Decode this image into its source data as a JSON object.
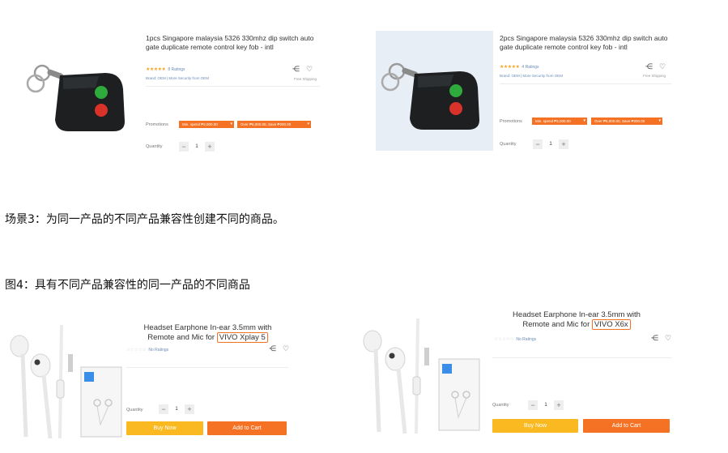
{
  "captions": {
    "scene3": "场景3：为同一产品的不同产品兼容性创建不同的商品。",
    "figure4": "图4：具有不同产品兼容性的同一产品的不同商品"
  },
  "colors": {
    "accent": "#f57224",
    "buy": "#fbb921",
    "star": "#f5a623",
    "link": "#6a8bb6"
  },
  "cards": [
    {
      "title": "1pcs Singapore malaysia 5326 330mhz dip switch auto gate duplicate remote control key fob - intl",
      "stars": "★★★★★",
      "rating_text": "8 Ratings",
      "brand_line": "Brand: OEM | More Security from OEM",
      "shipping": "Free Shipping",
      "promotions_label": "Promotions",
      "promo_1": "Min. spend ₱2,000.00",
      "promo_2": "Over ₱6,000.00, Save ₱200.00",
      "quantity_label": "Quantity",
      "minus": "−",
      "quantity": "1",
      "plus": "+",
      "share_icon": "share-icon",
      "heart_icon": "heart-icon"
    },
    {
      "title": "2pcs Singapore malaysia 5326 330mhz dip switch auto gate duplicate remote control key fob - intl",
      "stars": "★★★★★",
      "rating_text": "4 Ratings",
      "brand_line": "Brand: OEM | More Security from OEM",
      "shipping": "Free Shipping",
      "promotions_label": "Promotions",
      "promo_1": "Min. spend ₱2,000.00",
      "promo_2": "Over ₱6,000.00, Save ₱200.00",
      "quantity_label": "Quantity",
      "minus": "−",
      "quantity": "1",
      "plus": "+",
      "share_icon": "share-icon",
      "heart_icon": "heart-icon"
    },
    {
      "title_line1": "Headset Earphone In-ear 3.5mm with",
      "title_line2_prefix": "Remote and Mic for ",
      "title_highlight": "VIVO Xplay 5",
      "stars": "☆☆☆☆☆",
      "rating_text": "No Ratings",
      "quantity_label": "Quantity",
      "minus": "−",
      "quantity": "1",
      "plus": "+",
      "buy_now": "Buy Now",
      "add_to_cart": "Add to Cart",
      "share_icon": "share-icon",
      "heart_icon": "heart-icon"
    },
    {
      "title_line1": "Headset Earphone In-ear 3.5mm with",
      "title_line2_prefix": "Remote and Mic for ",
      "title_highlight": "VIVO X6x",
      "stars": "☆☆☆☆☆",
      "rating_text": "No Ratings",
      "quantity_label": "Quantity",
      "minus": "−",
      "quantity": "1",
      "plus": "+",
      "buy_now": "Buy Now",
      "add_to_cart": "Add to Cart",
      "share_icon": "share-icon",
      "heart_icon": "heart-icon"
    }
  ]
}
